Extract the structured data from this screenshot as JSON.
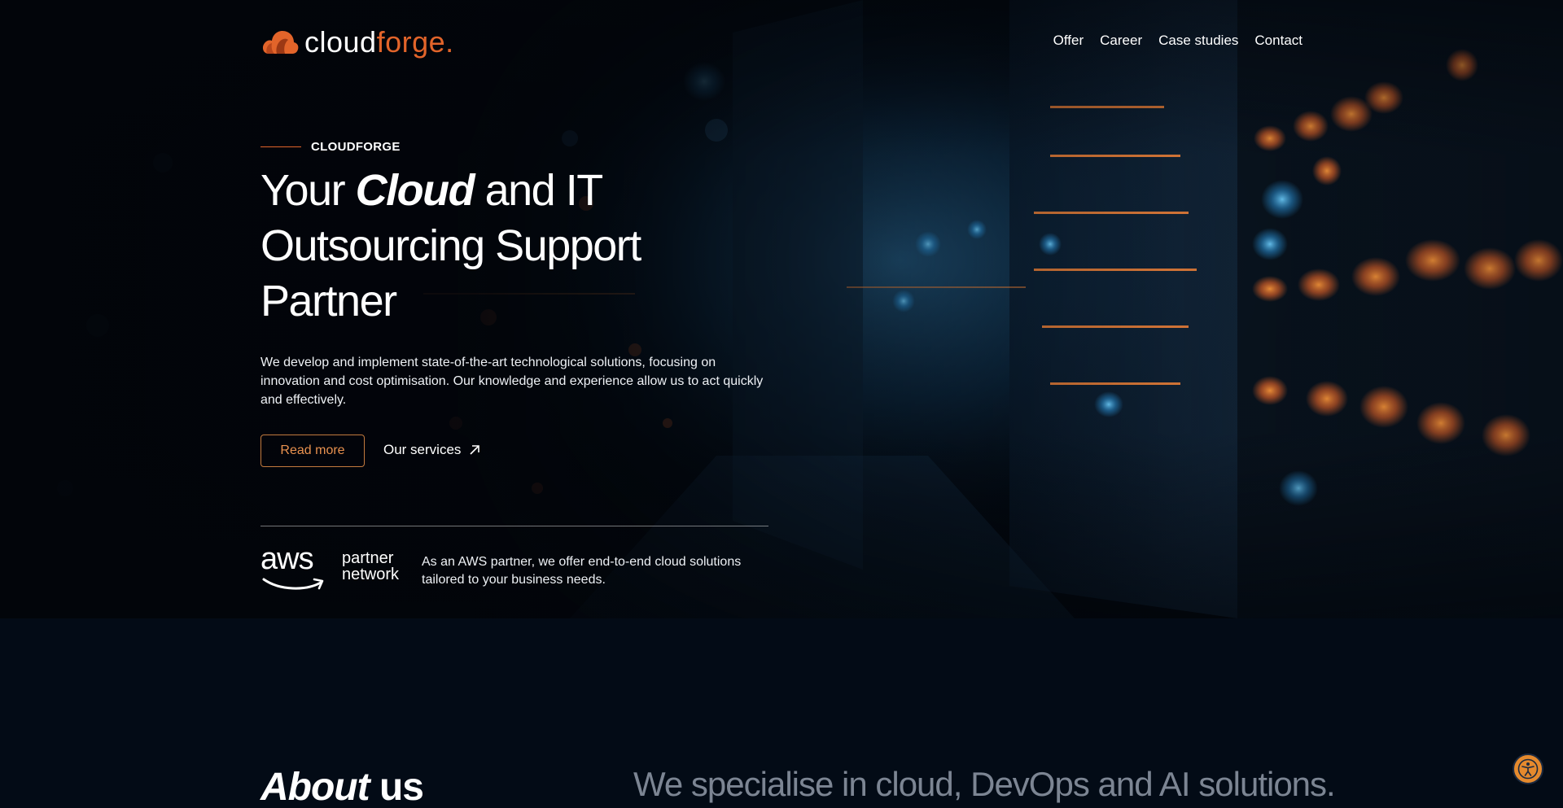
{
  "header": {
    "logo": {
      "part1": "cloud",
      "part2": "forge",
      "dot": "."
    },
    "nav": [
      {
        "label": "Offer"
      },
      {
        "label": "Career"
      },
      {
        "label": "Case studies"
      },
      {
        "label": "Contact"
      }
    ]
  },
  "hero": {
    "eyebrow": "CLOUDFORGE",
    "headline": {
      "pre": "Your ",
      "em": "Cloud",
      "post": " and IT Outsourcing Support Partner"
    },
    "lead": "We develop and implement state-of-the-art technological solutions, focusing on innovation and cost optimisation. Our knowledge and experience allow us to act quickly and effectively.",
    "read_more": "Read more",
    "our_services": "Our services",
    "aws": {
      "word": "aws",
      "partner_line1": "partner",
      "partner_line2": "network",
      "text": "As an AWS partner, we offer end-to-end cloud solutions tailored to your business needs."
    }
  },
  "about": {
    "title_em": "About",
    "title_rest": " us",
    "lead": "We specialise in cloud, DevOps and AI solutions."
  },
  "colors": {
    "accent": "#e2642a",
    "button_border": "#c27a3e",
    "background": "#030b16",
    "muted_text": "#7c8593"
  },
  "icons": {
    "logo": "cloud-logo-icon",
    "arrow": "arrow-up-right-icon",
    "accessibility": "accessibility-icon"
  }
}
